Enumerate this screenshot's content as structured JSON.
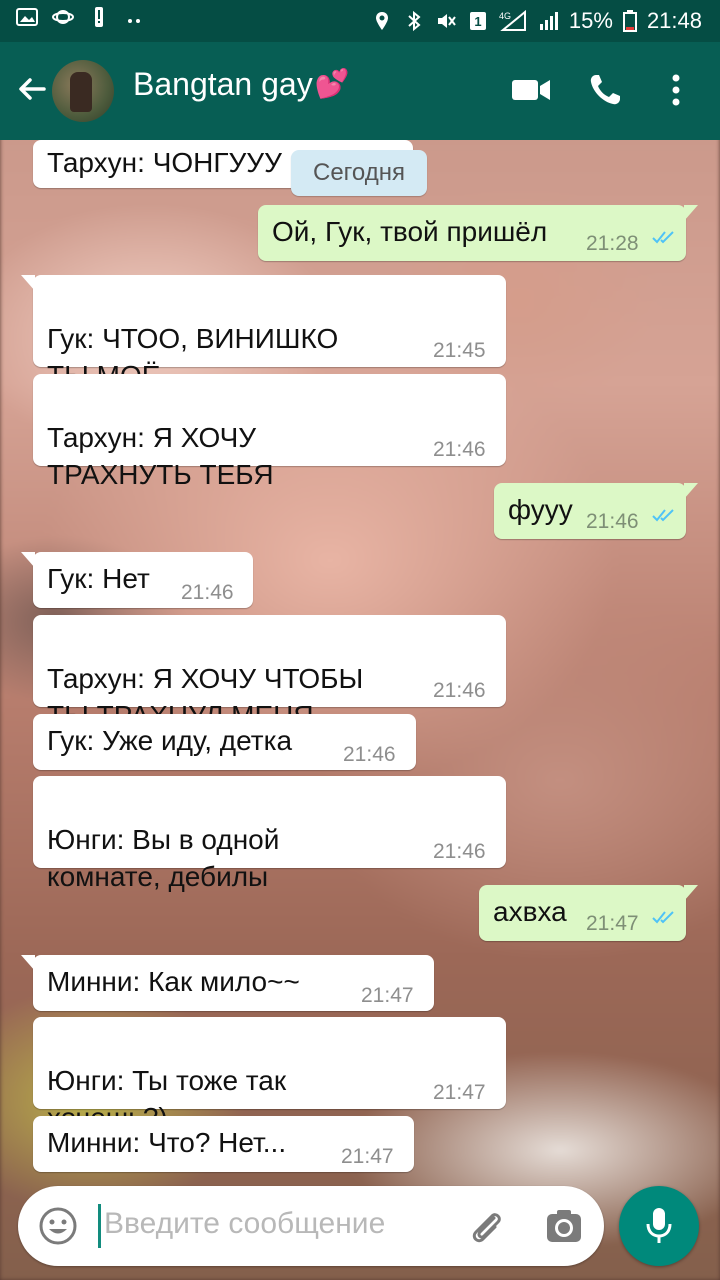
{
  "status_bar": {
    "battery": "15%",
    "time": "21:48"
  },
  "chat": {
    "name": "Bangtan gay",
    "date_chip": "Сегодня"
  },
  "messages": [
    {
      "text": "Тархун: ЧОНГУУУ",
      "time": "",
      "dir": "in"
    },
    {
      "text": "Ой, Гук, твой пришёл",
      "time": "21:28",
      "dir": "out"
    },
    {
      "text": "Гук: ЧТОО, ВИНИШКО\nТЫ МОЁ",
      "time": "21:45",
      "dir": "in"
    },
    {
      "text": "Тархун: Я ХОЧУ\nТРАХНУТЬ ТЕБЯ",
      "time": "21:46",
      "dir": "in"
    },
    {
      "text": "фууу",
      "time": "21:46",
      "dir": "out"
    },
    {
      "text": "Гук: Нет",
      "time": "21:46",
      "dir": "in"
    },
    {
      "text": "Тархун: Я ХОЧУ ЧТОБЫ\nТЫ ТРАХНУЛ МЕНЯ",
      "time": "21:46",
      "dir": "in"
    },
    {
      "text": "Гук: Уже иду, детка",
      "time": "21:46",
      "dir": "in"
    },
    {
      "text": "Юнги: Вы в одной\nкомнате, дебилы",
      "time": "21:46",
      "dir": "in"
    },
    {
      "text": "ахвха",
      "time": "21:47",
      "dir": "out"
    },
    {
      "text": "Минни: Как мило~~",
      "time": "21:47",
      "dir": "in"
    },
    {
      "text": "Юнги: Ты тоже так\nхочешь?)",
      "time": "21:47",
      "dir": "in"
    },
    {
      "text": "Минни: Что? Нет...",
      "time": "21:47",
      "dir": "in"
    }
  ],
  "input": {
    "placeholder": "Введите сообщение"
  },
  "icons": {
    "back": "arrow-left-icon",
    "video": "video-call-icon",
    "call": "phone-icon",
    "menu": "more-vert-icon",
    "emoji": "emoji-icon",
    "attach": "paperclip-icon",
    "camera": "camera-icon",
    "mic": "mic-icon"
  },
  "colors": {
    "header": "#075e54",
    "status_bar": "#054d44",
    "outgoing_bubble": "#dcf8c6",
    "incoming_bubble": "#ffffff",
    "read_ticks": "#4fc3f7",
    "mic_button": "#00897b"
  }
}
